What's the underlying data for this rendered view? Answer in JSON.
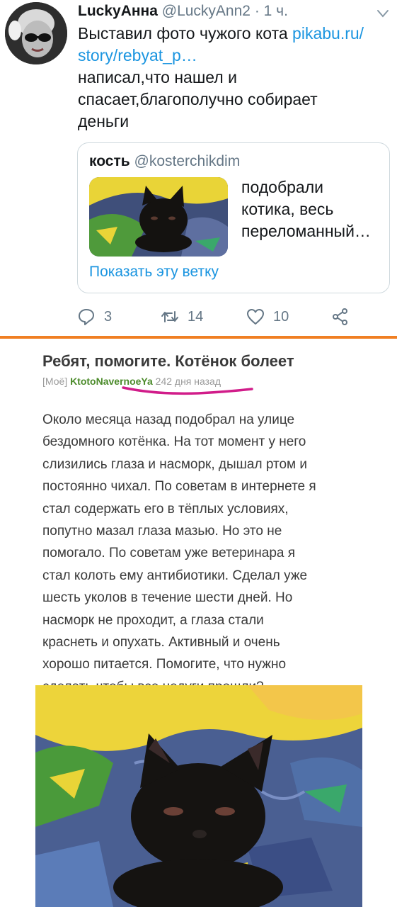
{
  "tweet": {
    "author_name": "LuckyАнна",
    "author_handle": "@LuckyAnn2",
    "separator": "·",
    "time": "1 ч.",
    "text_before_link": "Выставил фото чужого кота ",
    "link": "pikabu.ru/\nstory/rebyat_p…",
    "text_after_link": "\nнаписал,что нашел и\nспасает,благополучно собирает\nденьги",
    "quoted": {
      "author_name": "кость",
      "author_handle": "@kosterchikdim",
      "text": "подобрали\nкотика, весь\nпереломанный…",
      "show_thread": "Показать эту ветку"
    },
    "actions": {
      "replies": "3",
      "retweets": "14",
      "likes": "10"
    },
    "icons": [
      "chevron-down-icon",
      "reply-icon",
      "retweet-icon",
      "heart-icon",
      "share-icon"
    ]
  },
  "post": {
    "title": "Ребят, помогите. Котёнок болеет",
    "tag": "[Моё]",
    "author": "KtotoNavernoeYa",
    "date": "242 дня назад",
    "body": "Около месяца назад подобрал на улице\nбездомного котёнка. На тот момент у него\nслизились глаза и насморк, дышал ртом и\nпостоянно чихал. По советам в интернете я\nстал содержать его в тёплых условиях,\nпопутно мазал глаза мазью. Но это не\nпомогало. По советам уже ветеринара я\nстал колоть ему антибиотики. Сделал уже\nшесть уколов в течение шести дней. Но\nнасморк не проходит, а глаза стали\nкраснеть и опухать. Активный и очень\nхорошо питается. Помогите, что нужно\nсделать чтобы все недуги прошли?"
  },
  "colors": {
    "link_blue": "#1b95e0",
    "muted_gray": "#657786",
    "pikabu_orange": "#f07f22",
    "author_green": "#4c8b2b",
    "highlight_magenta": "#d11d8a"
  }
}
